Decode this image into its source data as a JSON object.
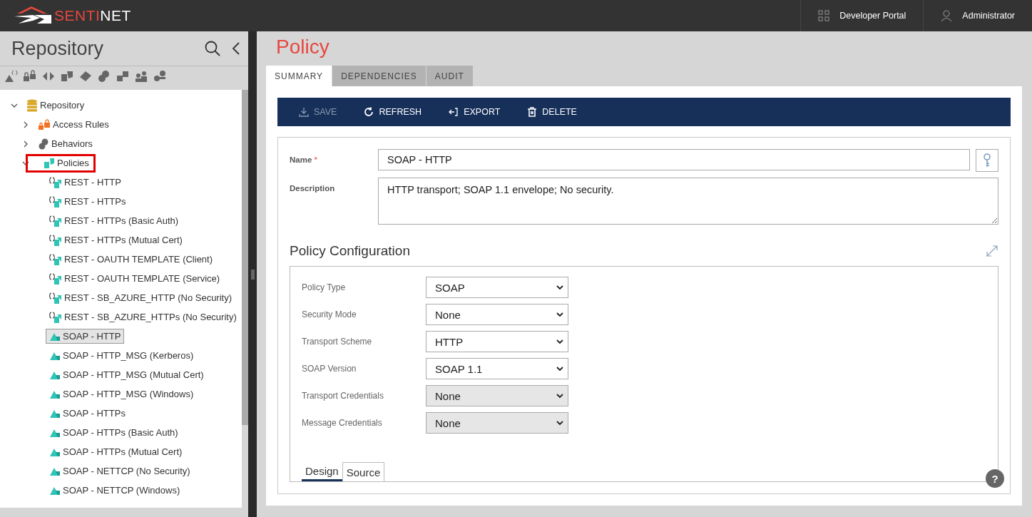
{
  "header": {
    "logo": {
      "accent": "SENTI",
      "rest": "NET"
    },
    "links": [
      {
        "label": "Developer Portal",
        "kind": "grid"
      },
      {
        "label": "Administrator",
        "kind": "user"
      }
    ]
  },
  "sidebar": {
    "title": "Repository",
    "tree": [
      {
        "label": "Repository",
        "kind": "database",
        "expanded": true,
        "selected": false,
        "highlighted": false,
        "children": [
          {
            "label": "Access Rules",
            "kind": "lock",
            "expanded": false,
            "selected": false,
            "highlighted": false
          },
          {
            "label": "Behaviors",
            "kind": "behavior",
            "expanded": false,
            "selected": false,
            "highlighted": false
          },
          {
            "label": "Policies",
            "kind": "policy",
            "expanded": true,
            "selected": false,
            "highlighted": true,
            "children": [
              {
                "label": "REST - HTTP",
                "kind": "rest",
                "selected": false
              },
              {
                "label": "REST - HTTPs",
                "kind": "rest",
                "selected": false
              },
              {
                "label": "REST - HTTPs (Basic Auth)",
                "kind": "rest",
                "selected": false
              },
              {
                "label": "REST - HTTPs (Mutual Cert)",
                "kind": "rest",
                "selected": false
              },
              {
                "label": "REST - OAUTH TEMPLATE (Client)",
                "kind": "rest",
                "selected": false
              },
              {
                "label": "REST - OAUTH TEMPLATE (Service)",
                "kind": "rest",
                "selected": false
              },
              {
                "label": "REST - SB_AZURE_HTTP (No Security)",
                "kind": "rest",
                "selected": false
              },
              {
                "label": "REST - SB_AZURE_HTTPs (No Security)",
                "kind": "rest",
                "selected": false
              },
              {
                "label": "SOAP - HTTP",
                "kind": "soap",
                "selected": true
              },
              {
                "label": "SOAP - HTTP_MSG (Kerberos)",
                "kind": "soap",
                "selected": false
              },
              {
                "label": "SOAP - HTTP_MSG (Mutual Cert)",
                "kind": "soap",
                "selected": false
              },
              {
                "label": "SOAP - HTTP_MSG (Windows)",
                "kind": "soap",
                "selected": false
              },
              {
                "label": "SOAP - HTTPs",
                "kind": "soap",
                "selected": false
              },
              {
                "label": "SOAP - HTTPs (Basic Auth)",
                "kind": "soap",
                "selected": false
              },
              {
                "label": "SOAP - HTTPs (Mutual Cert)",
                "kind": "soap",
                "selected": false
              },
              {
                "label": "SOAP - NETTCP (No Security)",
                "kind": "soap",
                "selected": false
              },
              {
                "label": "SOAP - NETTCP (Windows)",
                "kind": "soap",
                "selected": false
              }
            ]
          }
        ]
      }
    ]
  },
  "page": {
    "title": "Policy",
    "tabs": [
      {
        "label": "SUMMARY",
        "selected": true
      },
      {
        "label": "DEPENDENCIES",
        "selected": false
      },
      {
        "label": "AUDIT",
        "selected": false
      }
    ],
    "toolbar": [
      {
        "label": "SAVE",
        "kind": "save",
        "disabled": true
      },
      {
        "label": "REFRESH",
        "kind": "refresh",
        "disabled": false
      },
      {
        "label": "EXPORT",
        "kind": "export",
        "disabled": false
      },
      {
        "label": "DELETE",
        "kind": "delete",
        "disabled": false
      }
    ],
    "name": {
      "label": "Name",
      "required_mark": "*",
      "value": "SOAP - HTTP"
    },
    "description": {
      "label": "Description",
      "value": "HTTP transport; SOAP 1.1 envelope; No security."
    },
    "config": {
      "title": "Policy Configuration",
      "fields": [
        {
          "label": "Policy Type",
          "value": "SOAP",
          "disabled": false
        },
        {
          "label": "Security Mode",
          "value": "None",
          "disabled": false
        },
        {
          "label": "Transport Scheme",
          "value": "HTTP",
          "disabled": false
        },
        {
          "label": "SOAP Version",
          "value": "SOAP 1.1",
          "disabled": false
        },
        {
          "label": "Transport Credentials",
          "value": "None",
          "disabled": true
        },
        {
          "label": "Message Credentials",
          "value": "None",
          "disabled": true
        }
      ],
      "tabs": [
        {
          "label": "Design",
          "selected": true
        },
        {
          "label": "Source",
          "selected": false
        }
      ]
    },
    "help": "?"
  }
}
